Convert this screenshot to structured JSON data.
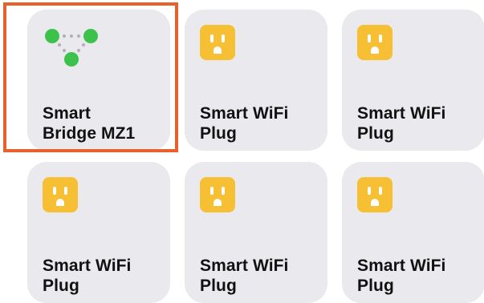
{
  "tiles": [
    {
      "label": "Smart\nBridge MZ1",
      "icon": "bridge-icon"
    },
    {
      "label": "Smart WiFi\nPlug",
      "icon": "plug-icon"
    },
    {
      "label": "Smart WiFi\nPlug",
      "icon": "plug-icon"
    },
    {
      "label": "Smart WiFi\nPlug",
      "icon": "plug-icon"
    },
    {
      "label": "Smart WiFi\nPlug",
      "icon": "plug-icon"
    },
    {
      "label": "Smart WiFi\nPlug",
      "icon": "plug-icon"
    }
  ],
  "colors": {
    "tile_bg": "#e9e9ee",
    "plug_yellow": "#f7c034",
    "bridge_green": "#3cc24a",
    "highlight": "#e8612c"
  }
}
